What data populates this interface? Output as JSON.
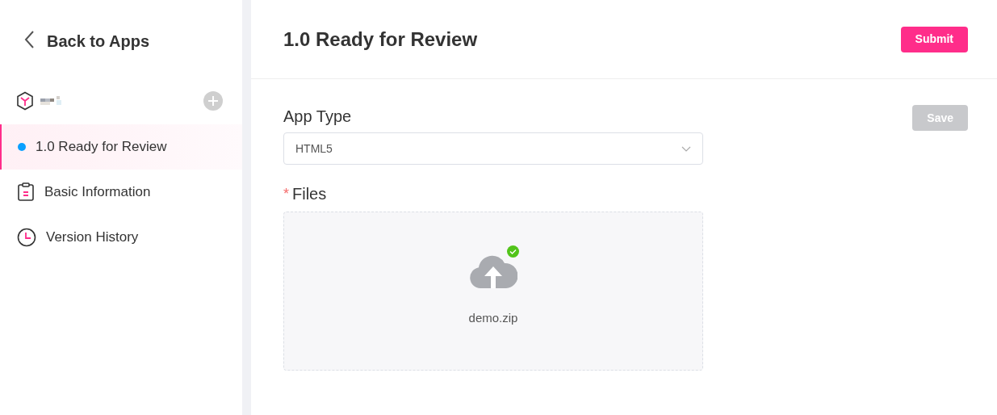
{
  "sidebar": {
    "back_link": "Back to Apps",
    "app": {
      "name_redacted": true
    },
    "items": [
      {
        "kind": "version",
        "label": "1.0 Ready for Review",
        "selected": true
      },
      {
        "kind": "info",
        "label": "Basic Information",
        "selected": false
      },
      {
        "kind": "history",
        "label": "Version History",
        "selected": false
      }
    ]
  },
  "header": {
    "title": "1.0 Ready for Review",
    "submit": {
      "label": "Submit",
      "disabled": false
    }
  },
  "form": {
    "save": {
      "label": "Save",
      "disabled": true
    },
    "app_type": {
      "label": "App Type",
      "value": "HTML5"
    },
    "files": {
      "label": "Files",
      "required_mark": "*",
      "file_name": "demo.zip",
      "uploaded": true
    }
  }
}
